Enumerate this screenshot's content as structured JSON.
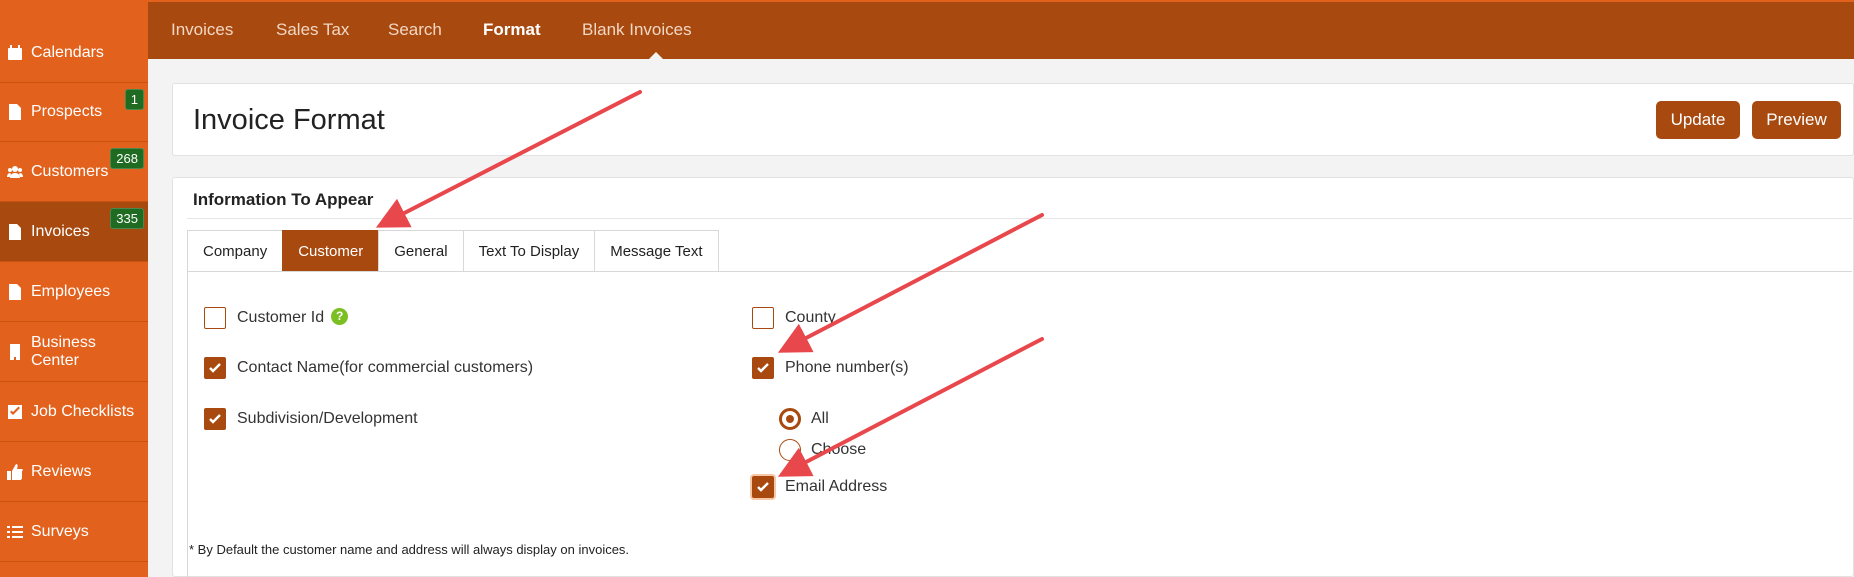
{
  "sidebar": {
    "items": [
      {
        "label": "Calendars",
        "icon": "calendar-icon",
        "badge": null,
        "active": false
      },
      {
        "label": "Prospects",
        "icon": "document-icon",
        "badge": "1",
        "active": false
      },
      {
        "label": "Customers",
        "icon": "users-icon",
        "badge": "268",
        "active": false
      },
      {
        "label": "Invoices",
        "icon": "document-icon",
        "badge": "335",
        "active": true
      },
      {
        "label": "Employees",
        "icon": "document-icon",
        "badge": null,
        "active": false
      },
      {
        "label": "Business Center",
        "icon": "building-icon",
        "badge": null,
        "active": false
      },
      {
        "label": "Job Checklists",
        "icon": "checkbox-icon",
        "badge": null,
        "active": false
      },
      {
        "label": "Reviews",
        "icon": "thumbs-up-icon",
        "badge": null,
        "active": false
      },
      {
        "label": "Surveys",
        "icon": "list-icon",
        "badge": null,
        "active": false
      }
    ]
  },
  "topnav": {
    "tabs": [
      "Invoices",
      "Sales Tax",
      "Search",
      "Format",
      "Blank Invoices"
    ],
    "active": "Format"
  },
  "header": {
    "title": "Invoice Format",
    "update_label": "Update",
    "preview_label": "Preview"
  },
  "section": {
    "title": "Information To Appear",
    "tabs": [
      "Company",
      "Customer",
      "General",
      "Text To Display",
      "Message Text"
    ],
    "active_tab": "Customer"
  },
  "options": {
    "customer_id": {
      "label": "Customer Id",
      "checked": false
    },
    "contact_name": {
      "label": "Contact Name(for commercial customers)",
      "checked": true
    },
    "subdivision": {
      "label": "Subdivision/Development",
      "checked": true
    },
    "county": {
      "label": "County",
      "checked": false
    },
    "phone": {
      "label": "Phone number(s)",
      "checked": true
    },
    "phone_all": {
      "label": "All",
      "selected": true
    },
    "phone_choose": {
      "label": "Choose",
      "selected": false
    },
    "email": {
      "label": "Email Address",
      "checked": true
    }
  },
  "footnote": "* By Default the customer name and address will always display on invoices.",
  "colors": {
    "sidebar": "#e2611c",
    "brand_dark": "#a84a0f",
    "badge": "#1f6b21",
    "annotation_arrow": "#e8474c",
    "help": "#7bbf22"
  }
}
